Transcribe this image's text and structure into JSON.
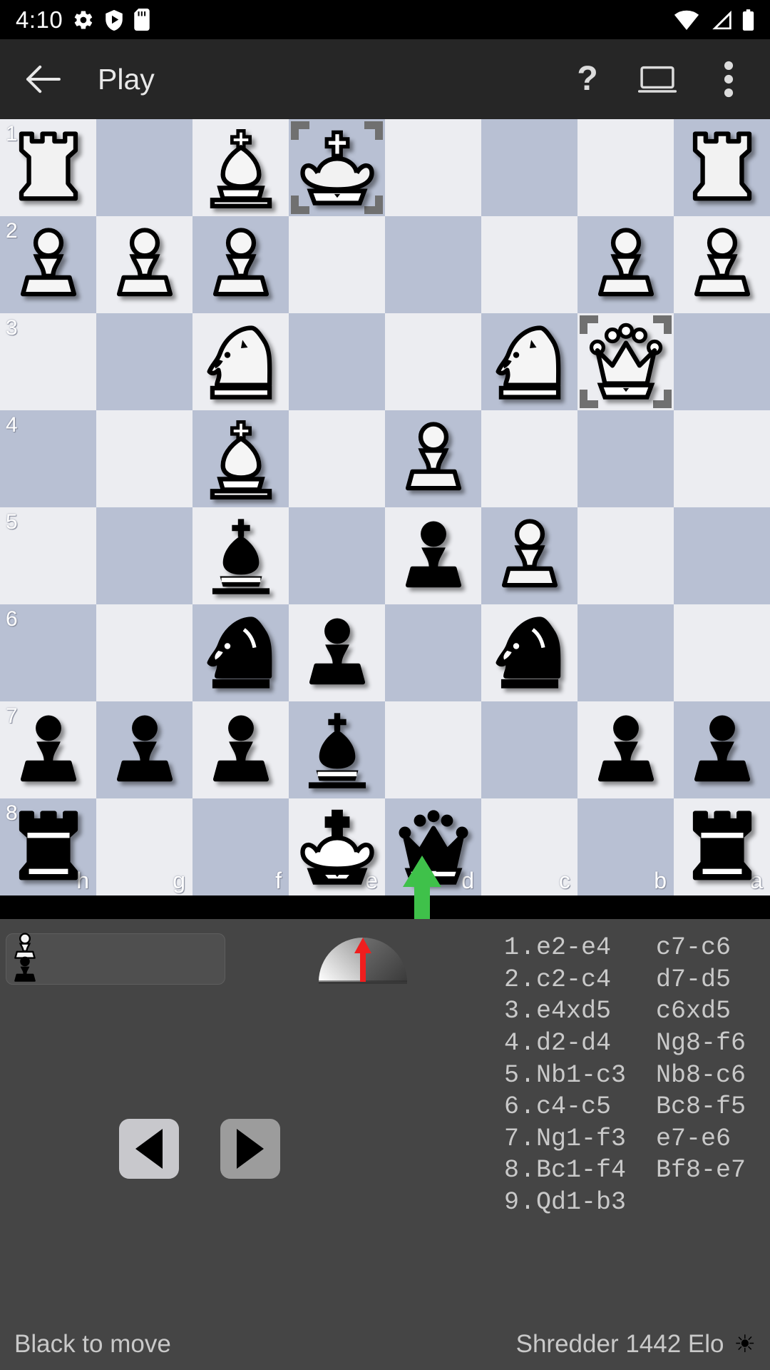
{
  "status_bar": {
    "time": "4:10",
    "left_icons": [
      "gear-icon",
      "shield-play-icon",
      "sd-card-icon"
    ],
    "right_icons": [
      "wifi-icon",
      "cell-signal-icon",
      "battery-icon"
    ]
  },
  "app_bar": {
    "back_label": "back-arrow",
    "title": "Play",
    "help_label": "?",
    "actions": [
      "help-button",
      "board-layout-button",
      "overflow-menu-button"
    ]
  },
  "board": {
    "orientation": "black",
    "file_labels": [
      "h",
      "g",
      "f",
      "e",
      "d",
      "c",
      "b",
      "a"
    ],
    "rank_labels": [
      "1",
      "2",
      "3",
      "4",
      "5",
      "6",
      "7",
      "8"
    ],
    "light_square_color": "#ecedf1",
    "dark_square_color": "#b8c0d3",
    "highlight_color": "#707070",
    "arrow_color": "#3fc14a",
    "highlighted_squares": [
      "e1",
      "b3"
    ],
    "arrow": {
      "from": "e7",
      "to": "e8",
      "visual": "up"
    },
    "rows": [
      [
        "wR",
        "",
        "wB",
        "wK",
        "",
        "",
        "",
        "wR"
      ],
      [
        "wP",
        "wP",
        "wP",
        "",
        "",
        "",
        "wP",
        "wP"
      ],
      [
        "",
        "",
        "wN",
        "",
        "",
        "wN",
        "wQ",
        ""
      ],
      [
        "",
        "",
        "wB",
        "",
        "wP",
        "",
        "",
        ""
      ],
      [
        "",
        "",
        "bB",
        "",
        "bP",
        "wP",
        "",
        ""
      ],
      [
        "",
        "",
        "bN",
        "bP",
        "",
        "bN",
        "",
        ""
      ],
      [
        "bP",
        "bP",
        "bP",
        "bB",
        "",
        "",
        "bP",
        "bP"
      ],
      [
        "bR",
        "",
        "",
        "bK",
        "bQ",
        "",
        "",
        "bR"
      ]
    ]
  },
  "captured": {
    "label": "captured-pieces",
    "white_pieces": [
      "wP"
    ],
    "black_pieces": [
      "bP"
    ]
  },
  "eval_gauge": {
    "label": "evaluation-gauge",
    "needle_direction": "up",
    "needle_color": "#f01e1e"
  },
  "nav": {
    "back_label": "step-backward",
    "forward_label": "step-forward"
  },
  "moves": [
    {
      "no": "1",
      "dot": ".",
      "white": "e2-e4",
      "black": "c7-c6"
    },
    {
      "no": "2",
      "dot": ".",
      "white": "c2-c4",
      "black": "d7-d5"
    },
    {
      "no": "3",
      "dot": ".",
      "white": "e4xd5",
      "black": "c6xd5"
    },
    {
      "no": "4",
      "dot": ".",
      "white": "d2-d4",
      "black": "Ng8-f6"
    },
    {
      "no": "5",
      "dot": ".",
      "white": "Nb1-c3",
      "black": "Nb8-c6"
    },
    {
      "no": "6",
      "dot": ".",
      "white": "c4-c5",
      "black": "Bc8-f5"
    },
    {
      "no": "7",
      "dot": ".",
      "white": "Ng1-f3",
      "black": "e7-e6"
    },
    {
      "no": "8",
      "dot": ".",
      "white": "Bc1-f4",
      "black": "Bf8-e7"
    },
    {
      "no": "9",
      "dot": ".",
      "white": "Qd1-b3",
      "black": ""
    }
  ],
  "bottom_status": {
    "turn": "Black to move",
    "engine": "Shredder 1442 Elo",
    "sun_icon": "☀"
  }
}
